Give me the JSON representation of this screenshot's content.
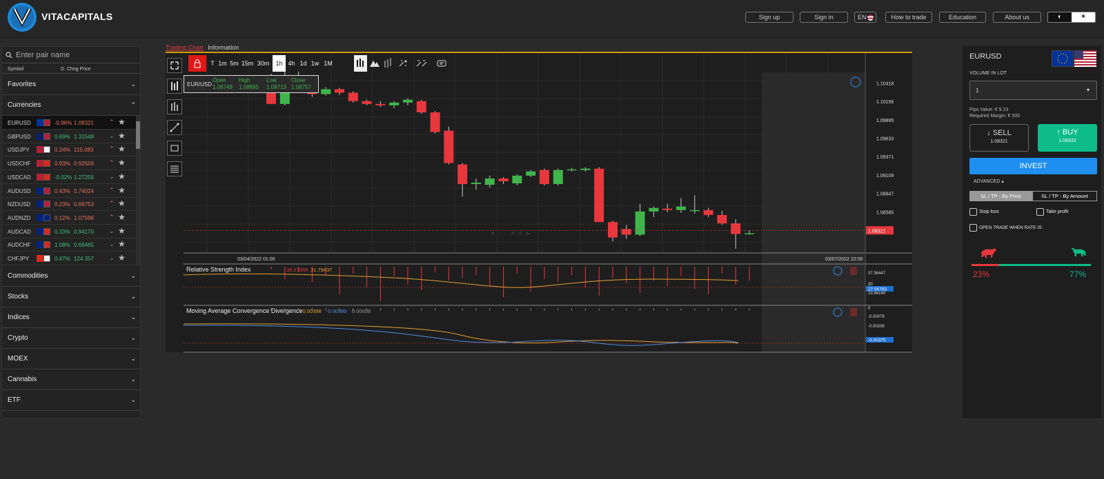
{
  "header": {
    "brand": "VITACAPITALS",
    "buttons": [
      "Sign up",
      "Sign in",
      "EN",
      "How to trade",
      "Education",
      "About us"
    ]
  },
  "sidebar": {
    "search_placeholder": "Enter pair name",
    "col_symbol": "Symbol",
    "col_chg_price": "D. Chng  Price",
    "favorites": "Favorites",
    "currencies": "Currencies",
    "rows": [
      {
        "sym": "EURUSD",
        "chg": "-0.96%",
        "price": "1.08321",
        "dir": "dn",
        "flag": [
          "#003399",
          "#b22234"
        ]
      },
      {
        "sym": "GBPUSD",
        "chg": "0.69%",
        "price": "1.31548",
        "dir": "up",
        "flag": [
          "#012169",
          "#b22234"
        ]
      },
      {
        "sym": "USDJPY",
        "chg": "0.24%",
        "price": "115.083",
        "dir": "dn",
        "flag": [
          "#b22234",
          "#ffffff"
        ]
      },
      {
        "sym": "USDCHF",
        "chg": "0.93%",
        "price": "0.92559",
        "dir": "dn",
        "flag": [
          "#b22234",
          "#d52b1e"
        ]
      },
      {
        "sym": "USDCAD",
        "chg": "-0.02%",
        "price": "1.27256",
        "dir": "up",
        "flag": [
          "#b22234",
          "#d52b1e"
        ]
      },
      {
        "sym": "AUDUSD",
        "chg": "0.43%",
        "price": "0.74024",
        "dir": "dn",
        "flag": [
          "#00247d",
          "#b22234"
        ]
      },
      {
        "sym": "NZDUSD",
        "chg": "0.23%",
        "price": "0.68753",
        "dir": "dn",
        "flag": [
          "#00247d",
          "#b22234"
        ]
      },
      {
        "sym": "AUDNZD",
        "chg": "0.12%",
        "price": "1.07596",
        "dir": "dn",
        "flag": [
          "#00247d",
          "#00247d"
        ]
      },
      {
        "sym": "AUDCAD",
        "chg": "0.33%",
        "price": "0.94170",
        "dir": "up",
        "flag": [
          "#00247d",
          "#d52b1e"
        ]
      },
      {
        "sym": "AUDCHF",
        "chg": "1.08%",
        "price": "0.68465",
        "dir": "up",
        "flag": [
          "#00247d",
          "#d52b1e"
        ]
      },
      {
        "sym": "CHFJPY",
        "chg": "0.47%",
        "price": "124.357",
        "dir": "up",
        "flag": [
          "#d52b1e",
          "#ffffff"
        ]
      }
    ],
    "categories": [
      "Commodities",
      "Stocks",
      "Indices",
      "Crypto",
      "MOEX",
      "Cannabis",
      "ETF"
    ]
  },
  "chart": {
    "tab_active": "Trading Chart",
    "tab_other": "Information",
    "timeframes": [
      "T",
      "1m",
      "5m",
      "15m",
      "30m",
      "1h",
      "4h",
      "1d",
      "1w",
      "1M"
    ],
    "active_tf": "1h",
    "ohlc": {
      "pair": "EUR/USD",
      "open_l": "Open",
      "open": "1.08749",
      "high_l": "High",
      "high": "1.08895",
      "low_l": "Low",
      "low": "1.08713",
      "close_l": "Close",
      "close": "1.08757"
    },
    "price_ticks": [
      "1.10418",
      "1.10156",
      "1.09895",
      "1.09633",
      "1.09371",
      "1.09109",
      "1.08847",
      "1.08585",
      "1.08324"
    ],
    "current_price": "1.08321",
    "date_left": "03/04/2022 01:00",
    "date_right": "03/07/2022 22:00",
    "rsi_title": "Relative Strength Index",
    "rsi_v1": "35.07569",
    "rsi_v2": "31.79437",
    "rsi_ticks": [
      "37.36447",
      "30",
      "23.94169"
    ],
    "rsi_current": "27.56783",
    "macd_title": "Moving Average Convergence Divergence",
    "macd_v1": "-0.00398",
    "macd_v2": "-0.00389",
    "macd_v3": "0.00008",
    "macd_ticks": [
      "0",
      "-0.00079",
      "-0.00208"
    ],
    "macd_current": "-0.00375",
    "candles": [
      [
        1.1045,
        1.1055,
        1.1012,
        1.1012
      ],
      [
        1.1012,
        1.106,
        1.101,
        1.1052
      ],
      [
        1.1052,
        1.1058,
        1.103,
        1.1034
      ],
      [
        1.103,
        1.1034,
        1.1022,
        1.1026
      ],
      [
        1.1026,
        1.1036,
        1.1024,
        1.1033
      ],
      [
        1.1033,
        1.1035,
        1.1025,
        1.1028
      ],
      [
        1.1028,
        1.103,
        1.1014,
        1.1016
      ],
      [
        1.1016,
        1.1018,
        1.101,
        1.1012
      ],
      [
        1.1012,
        1.1016,
        1.1008,
        1.101
      ],
      [
        1.101,
        1.1016,
        1.1006,
        1.1014
      ],
      [
        1.1014,
        1.102,
        1.101,
        1.1018
      ],
      [
        1.1016,
        1.1018,
        1.0998,
        1.1
      ],
      [
        1.1,
        1.1002,
        1.097,
        1.0972
      ],
      [
        1.0974,
        1.098,
        1.0926,
        1.0928
      ],
      [
        1.0926,
        1.0928,
        1.088,
        1.0898
      ],
      [
        1.0898,
        1.0906,
        1.089,
        1.09
      ],
      [
        1.0897,
        1.091,
        1.0893,
        1.0906
      ],
      [
        1.0906,
        1.0908,
        1.0898,
        1.0902
      ],
      [
        1.0899,
        1.0912,
        1.0896,
        1.091
      ],
      [
        1.091,
        1.0918,
        1.0908,
        1.0916
      ],
      [
        1.0918,
        1.092,
        1.0896,
        1.0898
      ],
      [
        1.0898,
        1.092,
        1.0896,
        1.0918
      ],
      [
        1.0918,
        1.0921,
        1.0916,
        1.0919
      ],
      [
        1.0918,
        1.0922,
        1.0916,
        1.092
      ],
      [
        1.092,
        1.0922,
        1.0844,
        1.0844
      ],
      [
        1.0844,
        1.0846,
        1.0816,
        1.0822
      ],
      [
        1.0834,
        1.084,
        1.082,
        1.0826
      ],
      [
        1.0826,
        1.087,
        1.0824,
        1.0859
      ],
      [
        1.0859,
        1.0866,
        1.0851,
        1.0864
      ],
      [
        1.0863,
        1.087,
        1.0858,
        1.0861
      ],
      [
        1.0861,
        1.0878,
        1.0857,
        1.0866
      ],
      [
        1.0861,
        1.0882,
        1.0856,
        1.0861
      ],
      [
        1.0861,
        1.0864,
        1.0851,
        1.0854
      ],
      [
        1.0854,
        1.086,
        1.084,
        1.0842
      ],
      [
        1.0842,
        1.0848,
        1.0806,
        1.0827
      ],
      [
        1.0827,
        1.0832,
        1.0826,
        1.0828
      ]
    ]
  },
  "right": {
    "pair": "EURUSD",
    "volume_label": "VOLUME IN LOT",
    "volume_value": "1",
    "pips": "Pips Value: € 9.23",
    "margin": "Required Margin: € 500",
    "sell_label": "SELL",
    "sell_price": "1.08321",
    "buy_label": "BUY",
    "buy_price": "1.08332",
    "invest": "INVEST",
    "advanced": "ADVANCED",
    "tab_price": "SL / TP - By Price",
    "tab_amount": "SL / TP - By Amount",
    "stop_loss": "Stop loss",
    "take_profit": "Take profit",
    "open_trade": "OPEN TRADE WHEN RATE IS:",
    "bear_pct": "23%",
    "bull_pct": "77%",
    "bear_value": 23,
    "bull_value": 77
  },
  "colors": {
    "up": "#3fb54b",
    "down": "#e8373d",
    "accent": "#d4a000",
    "buy": "#0ebc8a",
    "invest": "#1f8ef1"
  }
}
